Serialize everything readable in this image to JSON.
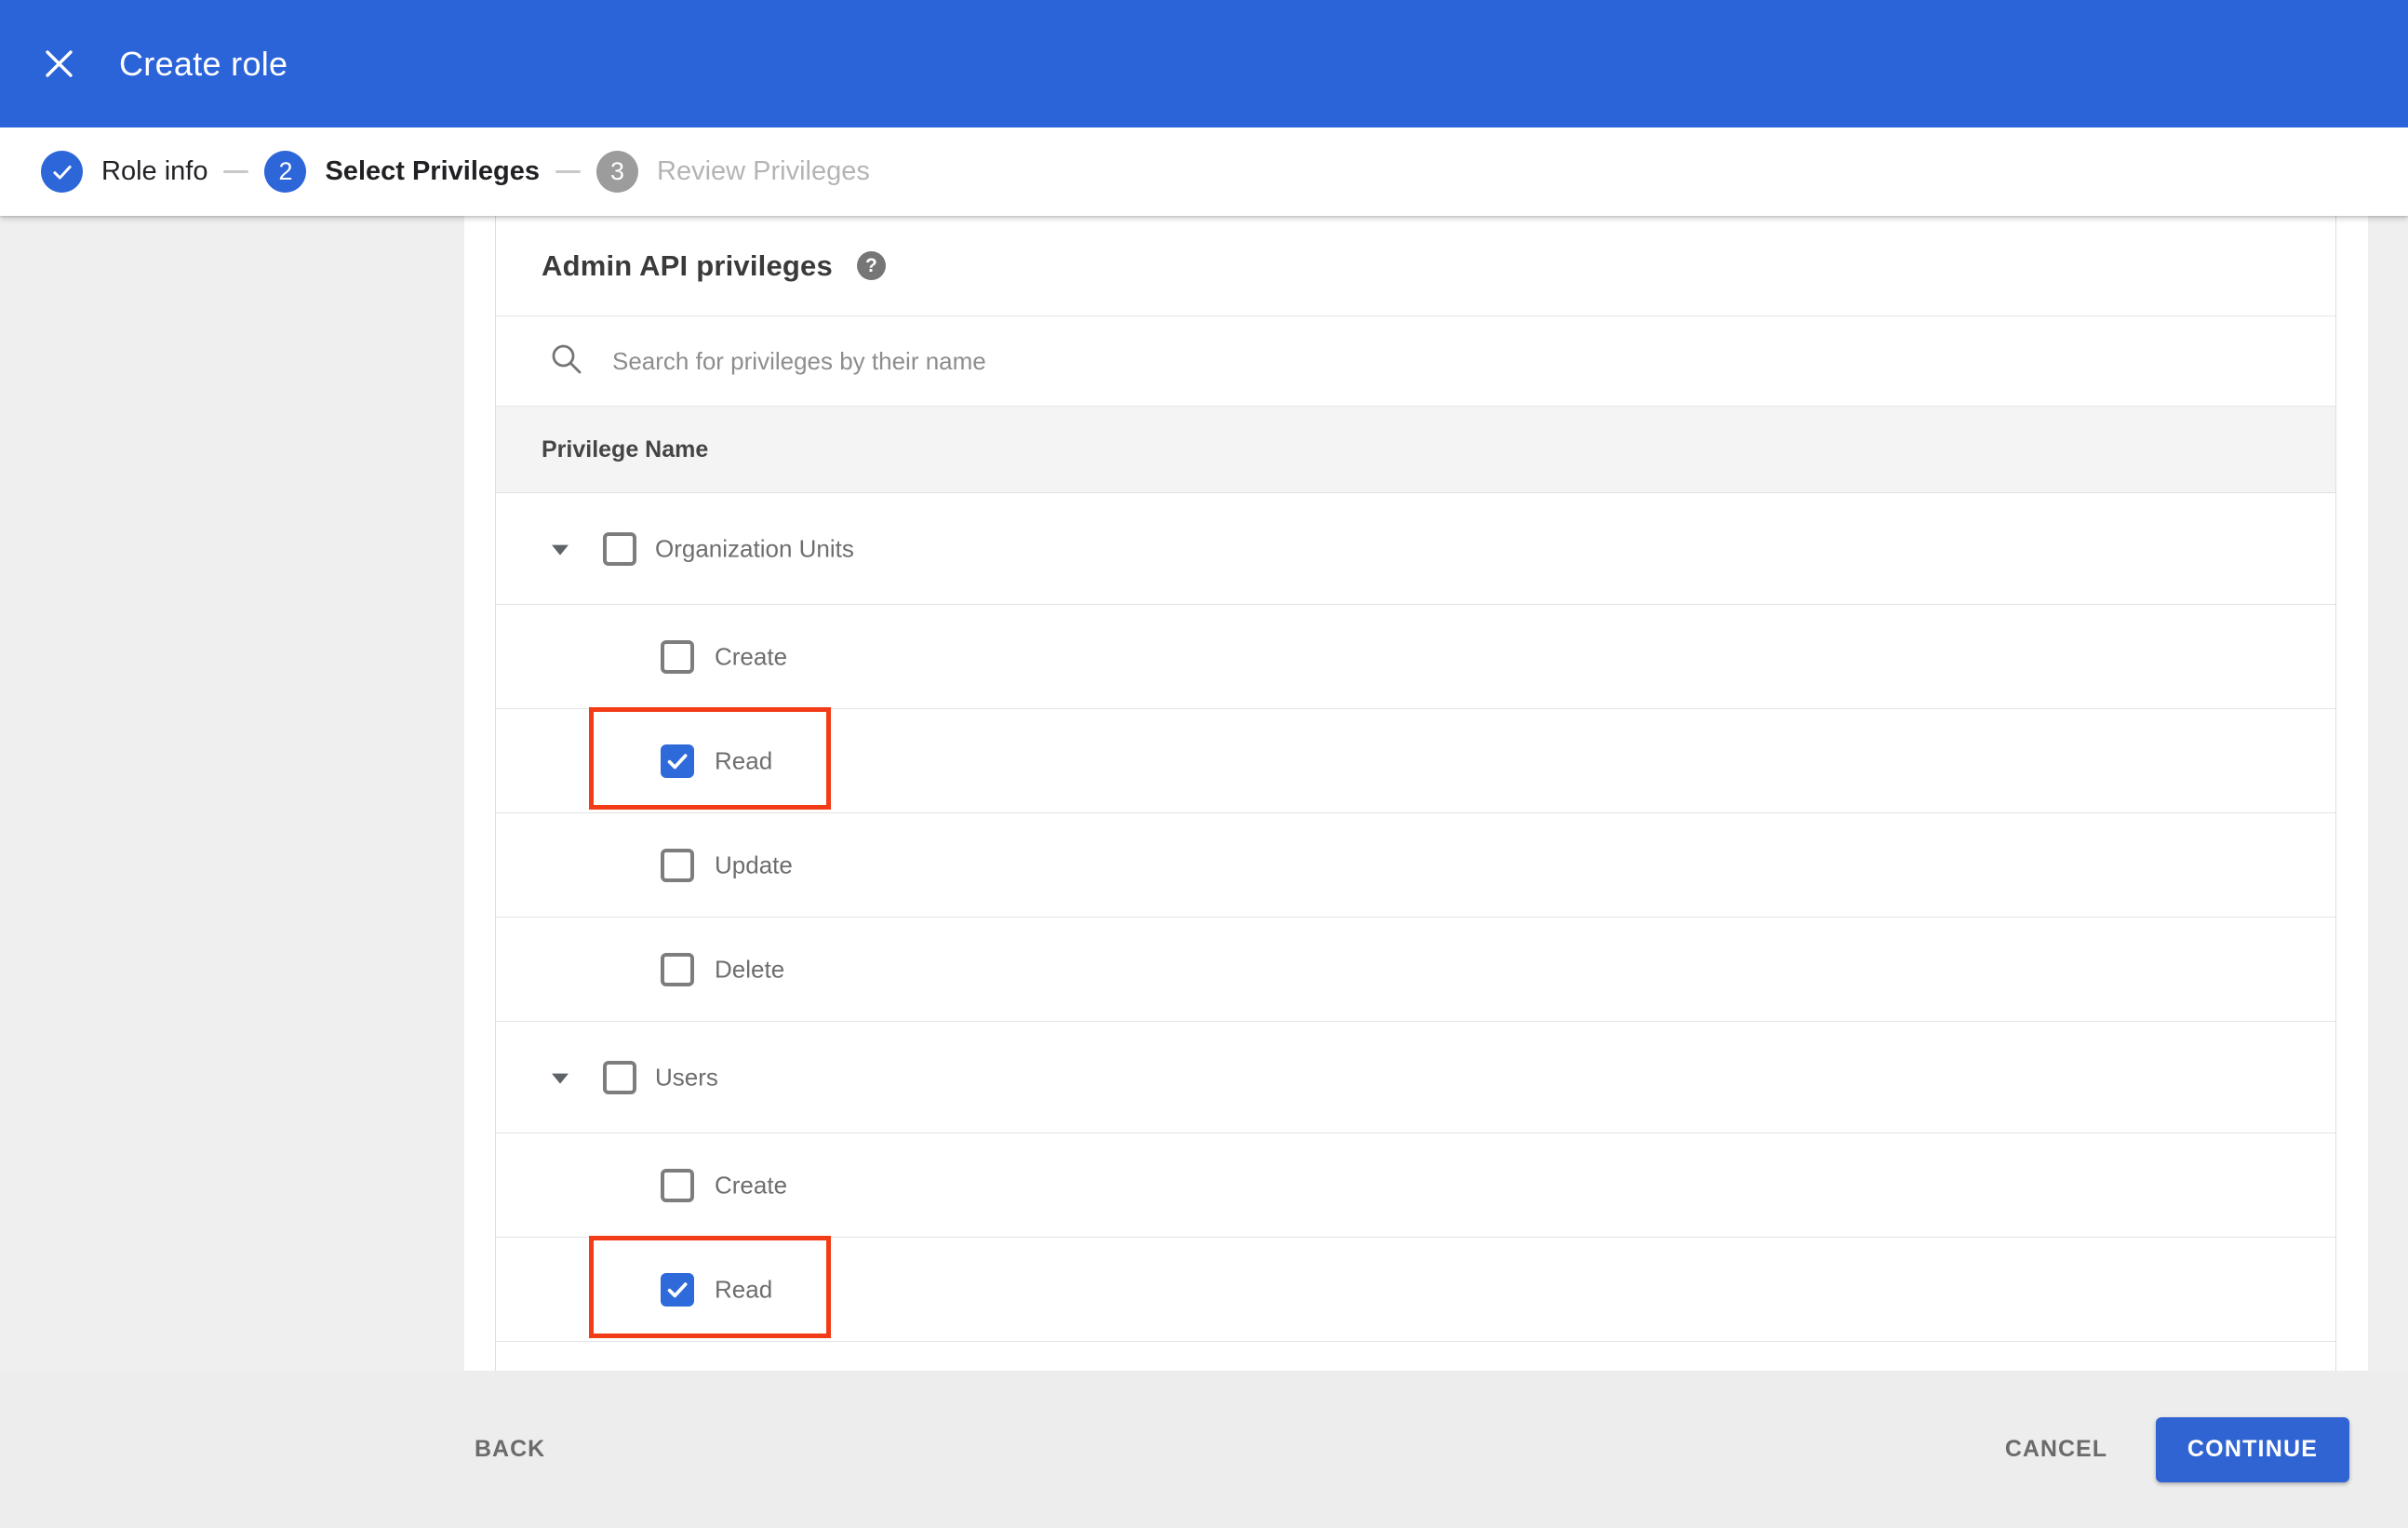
{
  "window": {
    "title": "Create role"
  },
  "icons": {
    "close": "✕",
    "step_check": "✓",
    "help": "?",
    "search": "magnifier",
    "expand_down": "▼",
    "checkbox_check": "✓"
  },
  "colors": {
    "header_blue": "#2b63d8",
    "accent_blue": "#2d66d9",
    "checkbox_blue": "#2e6ad9",
    "continue_blue": "#3164d3",
    "highlight_red": "#f23b17"
  },
  "stepper": {
    "steps": [
      {
        "marker": "✓",
        "label": "Role info",
        "state": "complete"
      },
      {
        "marker": "2",
        "label": "Select Privileges",
        "state": "current"
      },
      {
        "marker": "3",
        "label": "Review Privileges",
        "state": "upcoming"
      }
    ]
  },
  "panel": {
    "heading": "Admin API privileges",
    "help_label": "?",
    "search": {
      "placeholder": "Search for privileges by their name",
      "value": ""
    },
    "table": {
      "header": "Privilege Name",
      "rows": [
        {
          "id": "organization-units",
          "label": "Organization Units",
          "level": 0,
          "expanded": true,
          "checked": false
        },
        {
          "id": "organization-units-create",
          "label": "Create",
          "level": 1,
          "checked": false
        },
        {
          "id": "organization-units-read",
          "label": "Read",
          "level": 1,
          "checked": true,
          "highlighted": true
        },
        {
          "id": "organization-units-update",
          "label": "Update",
          "level": 1,
          "checked": false
        },
        {
          "id": "organization-units-delete",
          "label": "Delete",
          "level": 1,
          "checked": false
        },
        {
          "id": "users",
          "label": "Users",
          "level": 0,
          "expanded": true,
          "checked": false
        },
        {
          "id": "users-create",
          "label": "Create",
          "level": 1,
          "checked": false
        },
        {
          "id": "users-read",
          "label": "Read",
          "level": 1,
          "checked": true,
          "highlighted": true
        }
      ]
    }
  },
  "footer": {
    "back_label": "BACK",
    "cancel_label": "CANCEL",
    "continue_label": "CONTINUE"
  }
}
